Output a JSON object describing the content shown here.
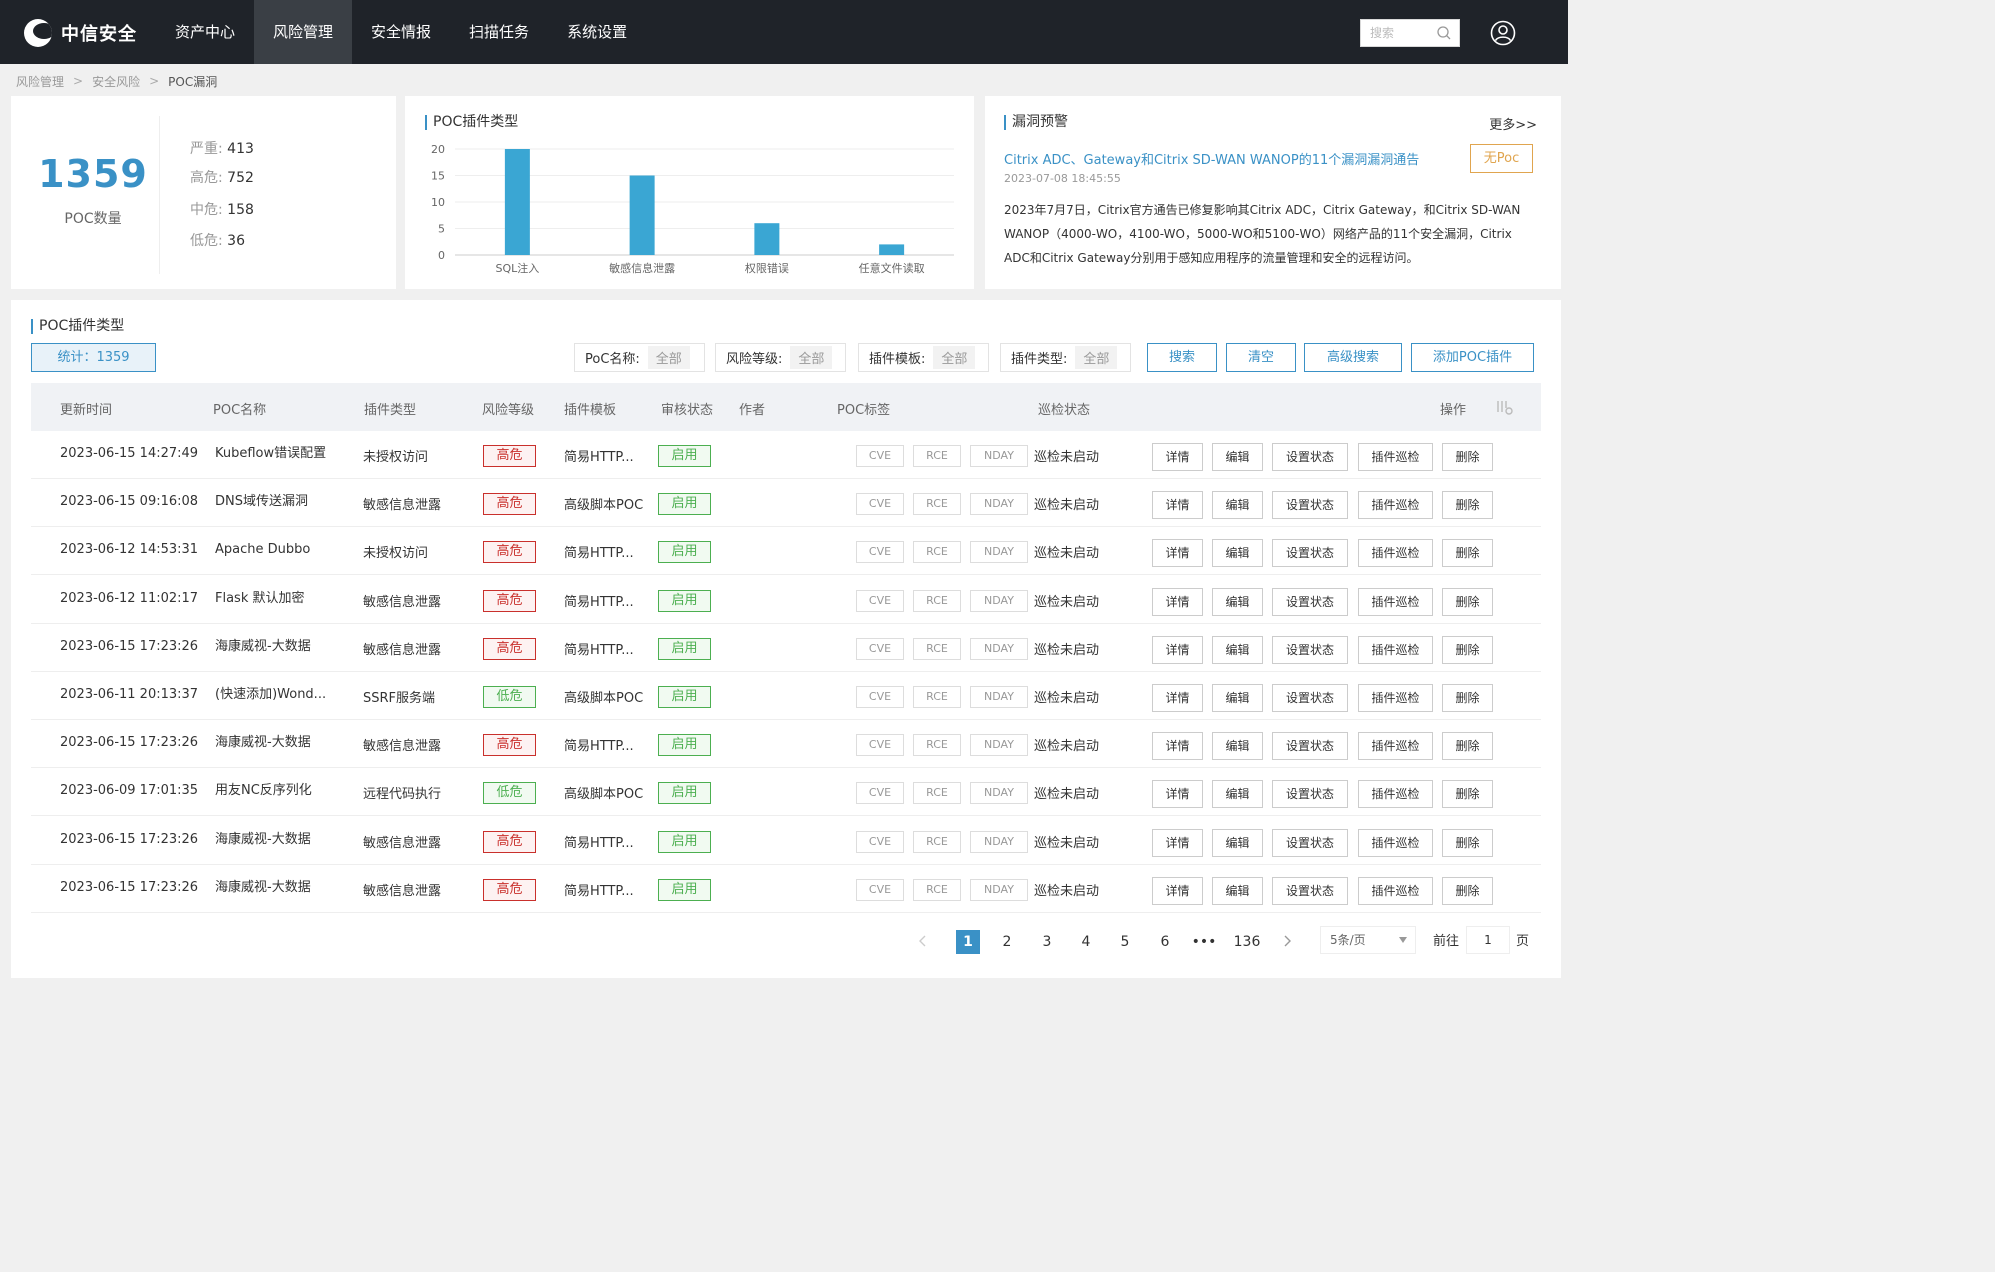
{
  "app": {
    "logo_text": "中信安全"
  },
  "nav": {
    "items": [
      {
        "label": "资产中心"
      },
      {
        "label": "风险管理"
      },
      {
        "label": "安全情报"
      },
      {
        "label": "扫描任务"
      },
      {
        "label": "系统设置"
      }
    ],
    "active_index": 1
  },
  "search": {
    "placeholder": "搜索",
    "value": ""
  },
  "breadcrumb": [
    "风险管理",
    "安全风险",
    "POC漏洞"
  ],
  "stats": {
    "total": "1359",
    "total_label": "POC数量",
    "rows": [
      {
        "label": "严重:",
        "value": "413"
      },
      {
        "label": "高危:",
        "value": "752"
      },
      {
        "label": "中危:",
        "value": "158"
      },
      {
        "label": "低危:",
        "value": "36"
      }
    ]
  },
  "chart_data": {
    "type": "bar",
    "title": "POC插件类型",
    "categories": [
      "SQL注入",
      "敏感信息泄露",
      "权限错误",
      "任意文件读取"
    ],
    "values": [
      20,
      15,
      6,
      2
    ],
    "ylim": [
      0,
      20
    ],
    "yticks": [
      0,
      5,
      10,
      15,
      20
    ],
    "xlabel": "",
    "ylabel": "",
    "grid": true,
    "color": "#3aa6d3"
  },
  "alert": {
    "title": "漏洞预警",
    "more": "更多>>",
    "link_text": "Citrix ADC、Gateway和Citrix SD-WAN WANOP的11个漏洞漏洞通告",
    "tag": "无Poc",
    "date": "2023-07-08 18:45:55",
    "body": "2023年7月7日，Citrix官方通告已修复影响其Citrix ADC，Citrix Gateway，和Citrix SD-WAN WANOP（4000-WO，4100-WO，5000-WO和5100-WO）网络产品的11个安全漏洞，Citrix ADC和Citrix Gateway分别用于感知应用程序的流量管理和安全的远程访问。"
  },
  "table_section": {
    "title": "POC插件类型",
    "count_label": "统计：1359",
    "filters": [
      {
        "label": "PoC名称:",
        "value": "全部"
      },
      {
        "label": "风险等级:",
        "value": "全部"
      },
      {
        "label": "插件模板:",
        "value": "全部"
      },
      {
        "label": "插件类型:",
        "value": "全部"
      }
    ],
    "buttons": {
      "search": "搜索",
      "clear": "清空",
      "advanced": "高级搜索",
      "add": "添加POC插件"
    },
    "columns": [
      "更新时间",
      "POC名称",
      "插件类型",
      "风险等级",
      "插件模板",
      "审核状态",
      "作者",
      "POC标签",
      "巡检状态",
      "操作"
    ],
    "row_actions": [
      "详情",
      "编辑",
      "设置状态",
      "插件巡检",
      "删除"
    ],
    "rows": [
      {
        "time": "2023-06-15 14:27:49",
        "name": "Kubeflow错误配置",
        "type": "未授权访问",
        "risk": "高危",
        "risk_level": "high",
        "template": "简易HTTP...",
        "status": "启用",
        "author": "",
        "tags": [
          "CVE",
          "RCE",
          "NDAY"
        ],
        "patrol": "巡检未启动"
      },
      {
        "time": "2023-06-15 09:16:08",
        "name": "DNS域传送漏洞",
        "type": "敏感信息泄露",
        "risk": "高危",
        "risk_level": "high",
        "template": "高级脚本POC",
        "status": "启用",
        "author": "",
        "tags": [
          "CVE",
          "RCE",
          "NDAY"
        ],
        "patrol": "巡检未启动"
      },
      {
        "time": "2023-06-12 14:53:31",
        "name": "Apache Dubbo",
        "type": "未授权访问",
        "risk": "高危",
        "risk_level": "high",
        "template": "简易HTTP...",
        "status": "启用",
        "author": "",
        "tags": [
          "CVE",
          "RCE",
          "NDAY"
        ],
        "patrol": "巡检未启动"
      },
      {
        "time": "2023-06-12 11:02:17",
        "name": "Flask 默认加密",
        "type": "敏感信息泄露",
        "risk": "高危",
        "risk_level": "high",
        "template": "简易HTTP...",
        "status": "启用",
        "author": "",
        "tags": [
          "CVE",
          "RCE",
          "NDAY"
        ],
        "patrol": "巡检未启动"
      },
      {
        "time": "2023-06-15 17:23:26",
        "name": "海康威视-大数据",
        "type": "敏感信息泄露",
        "risk": "高危",
        "risk_level": "high",
        "template": "简易HTTP...",
        "status": "启用",
        "author": "",
        "tags": [
          "CVE",
          "RCE",
          "NDAY"
        ],
        "patrol": "巡检未启动"
      },
      {
        "time": "2023-06-11 20:13:37",
        "name": "(快速添加)Wond...",
        "type": "SSRF服务端",
        "risk": "低危",
        "risk_level": "low",
        "template": "高级脚本POC",
        "status": "启用",
        "author": "",
        "tags": [
          "CVE",
          "RCE",
          "NDAY"
        ],
        "patrol": "巡检未启动"
      },
      {
        "time": "2023-06-15 17:23:26",
        "name": "海康威视-大数据",
        "type": "敏感信息泄露",
        "risk": "高危",
        "risk_level": "high",
        "template": "简易HTTP...",
        "status": "启用",
        "author": "",
        "tags": [
          "CVE",
          "RCE",
          "NDAY"
        ],
        "patrol": "巡检未启动"
      },
      {
        "time": "2023-06-09 17:01:35",
        "name": "用友NC反序列化",
        "type": "远程代码执行",
        "risk": "低危",
        "risk_level": "low",
        "template": "高级脚本POC",
        "status": "启用",
        "author": "",
        "tags": [
          "CVE",
          "RCE",
          "NDAY"
        ],
        "patrol": "巡检未启动"
      },
      {
        "time": "2023-06-15 17:23:26",
        "name": "海康威视-大数据",
        "type": "敏感信息泄露",
        "risk": "高危",
        "risk_level": "high",
        "template": "简易HTTP...",
        "status": "启用",
        "author": "",
        "tags": [
          "CVE",
          "RCE",
          "NDAY"
        ],
        "patrol": "巡检未启动"
      },
      {
        "time": "2023-06-15 17:23:26",
        "name": "海康威视-大数据",
        "type": "敏感信息泄露",
        "risk": "高危",
        "risk_level": "high",
        "template": "简易HTTP...",
        "status": "启用",
        "author": "",
        "tags": [
          "CVE",
          "RCE",
          "NDAY"
        ],
        "patrol": "巡检未启动"
      }
    ]
  },
  "pagination": {
    "pages": [
      "1",
      "2",
      "3",
      "4",
      "5",
      "6",
      "•••",
      "136"
    ],
    "current": "1",
    "page_size": "5条/页",
    "goto_label": "前往",
    "goto_value": "1",
    "goto_suffix": "页"
  },
  "colors": {
    "accent": "#3a91c6",
    "topbar": "#1f2329",
    "high_risk": "#c9302c",
    "low_risk": "#4caf50",
    "warning": "#e0a54f"
  }
}
